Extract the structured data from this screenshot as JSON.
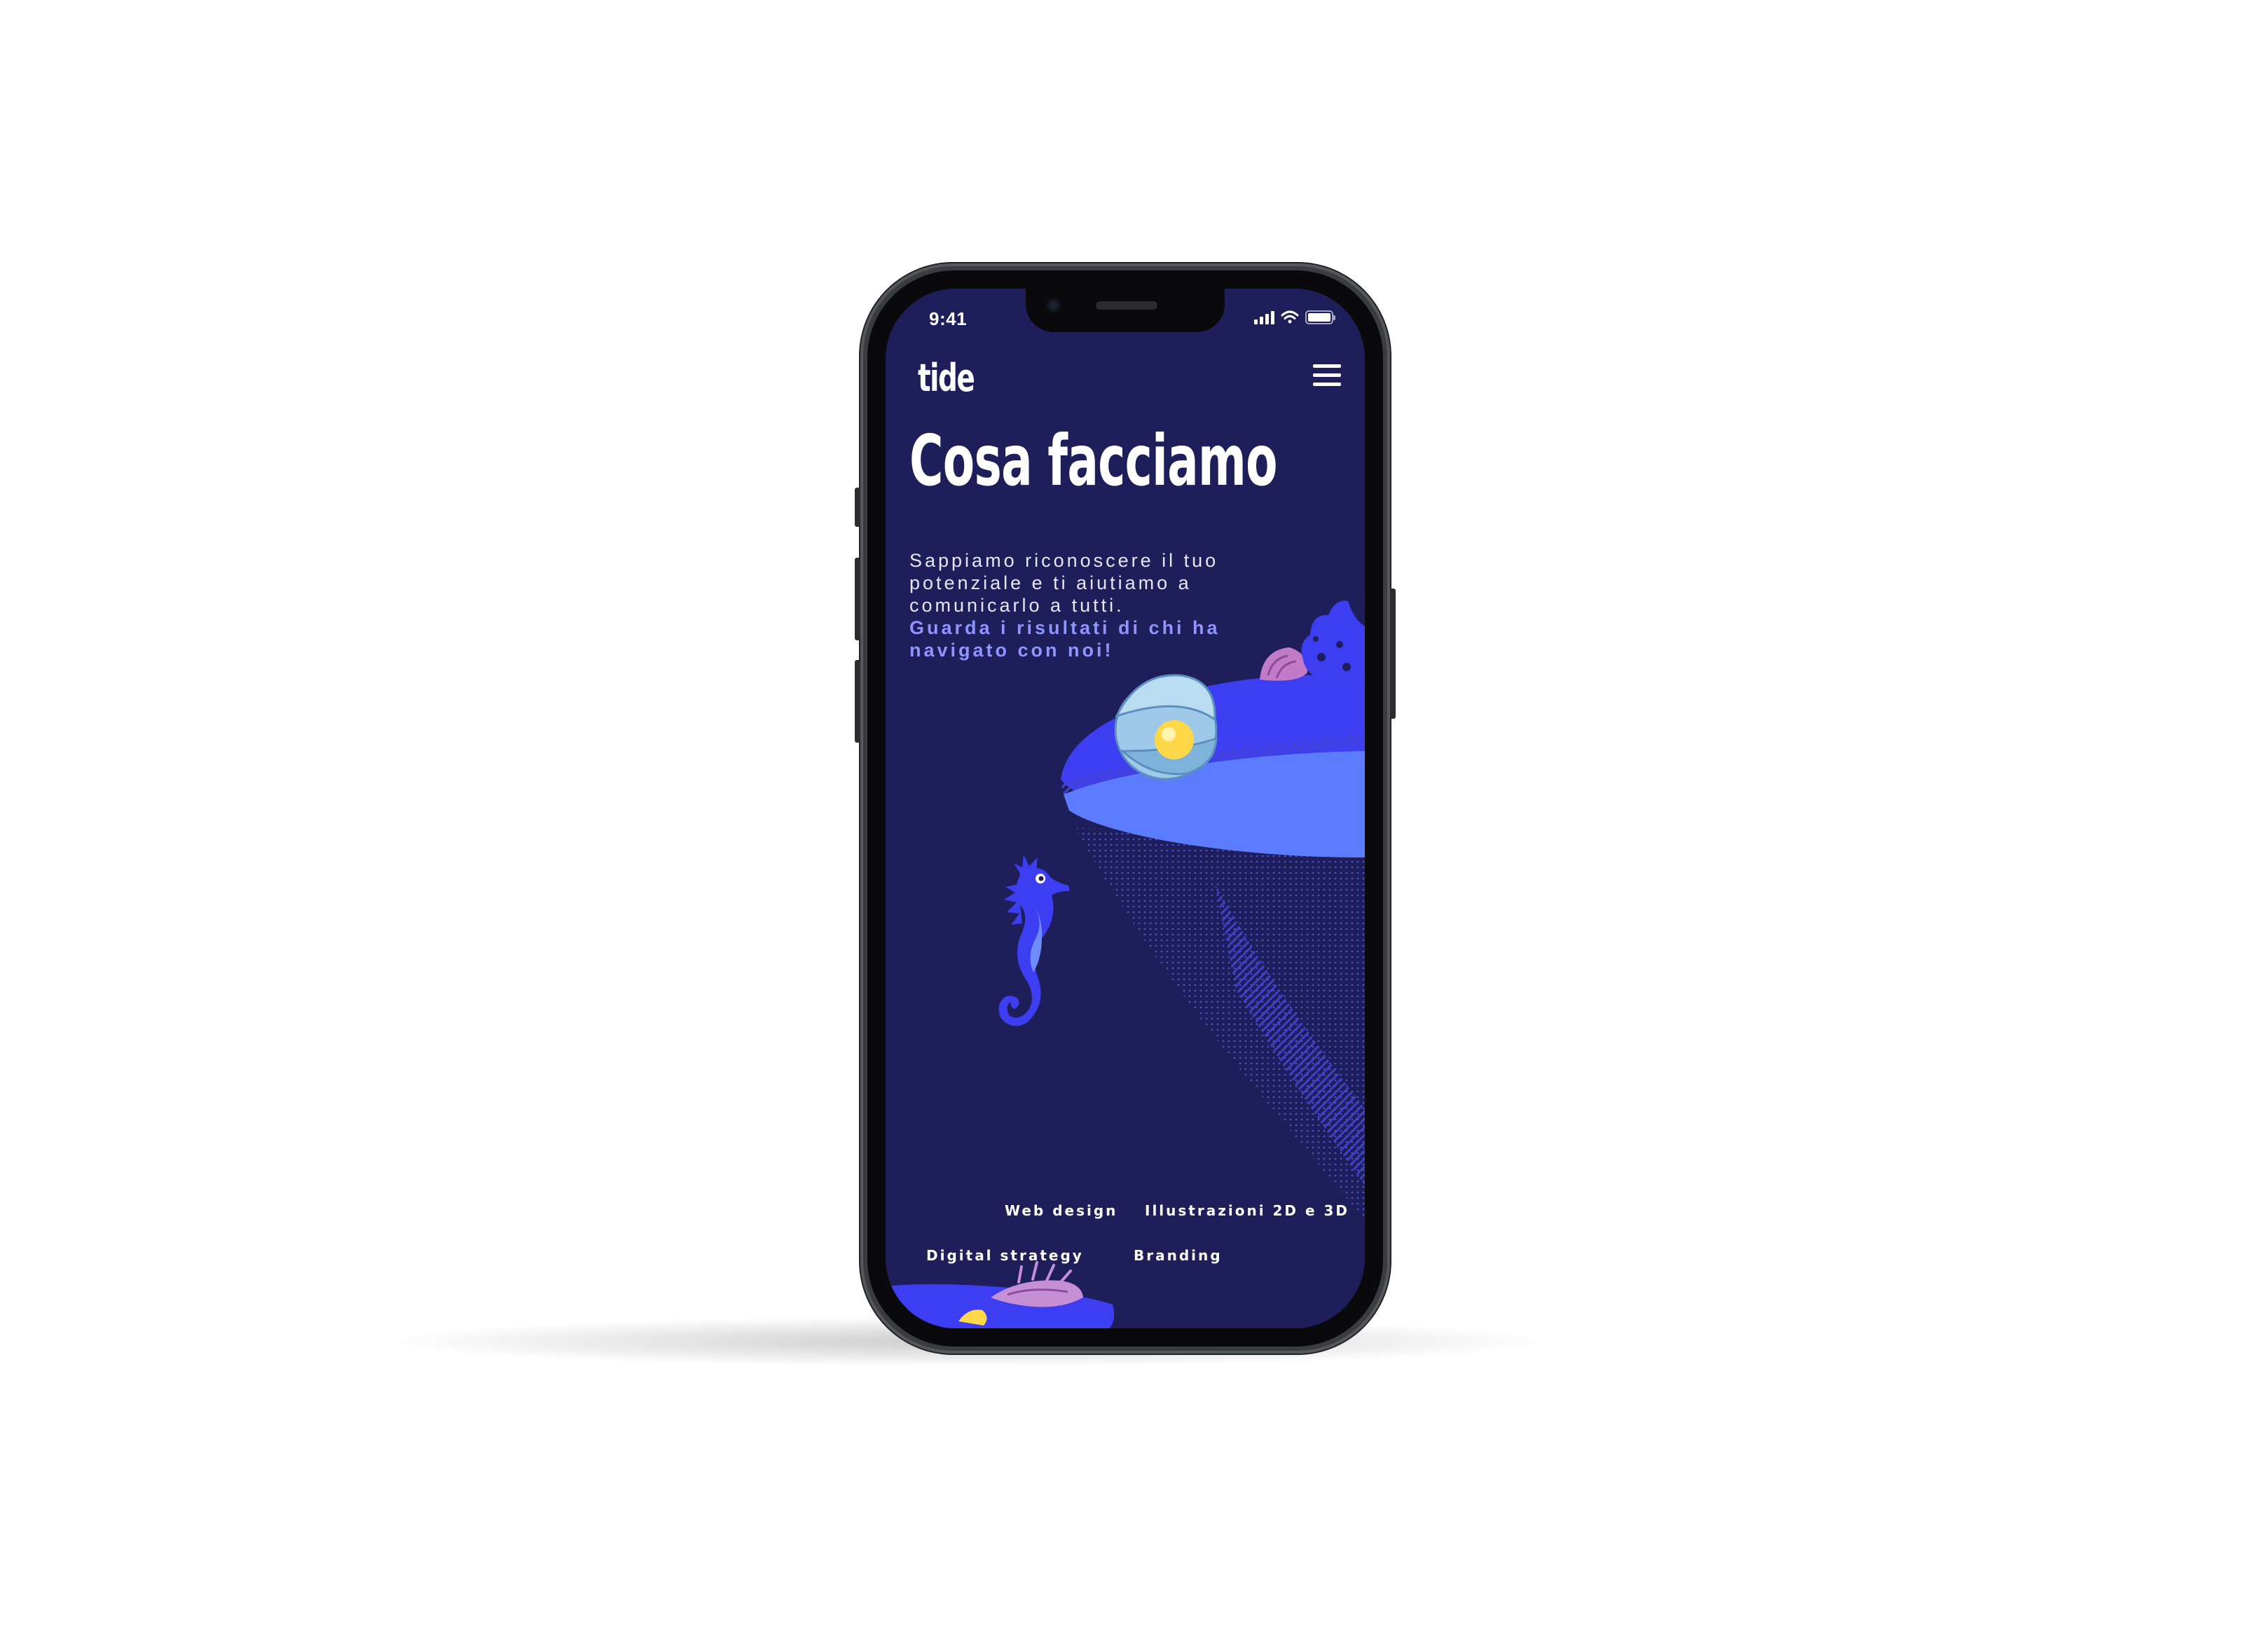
{
  "status_bar": {
    "time": "9:41"
  },
  "header": {
    "logo": "tide",
    "menu_icon": "hamburger-menu-icon"
  },
  "hero": {
    "title": "Cosa facciamo",
    "description": "Sappiamo riconoscere il tuo potenziale e ti aiutiamo a comunicarlo a tutti.",
    "link": "Guarda i risultati di chi ha navigato con noi!"
  },
  "services": {
    "web_design": "Web design",
    "illustrations": "Illustrazioni 2D e 3D",
    "digital_strategy": "Digital strategy",
    "branding": "Branding"
  },
  "illustrations": {
    "items": [
      "pearl-oyster-icon",
      "seashell-icon",
      "coral-icon",
      "seahorse-icon",
      "spiky-shell-icon"
    ]
  },
  "colors": {
    "screen_background": "#1e1e5a",
    "reef_primary": "#3d3df2",
    "reef_secondary": "#5b7cff",
    "link_accent": "#8f94ff",
    "text_primary": "#ffffff"
  }
}
